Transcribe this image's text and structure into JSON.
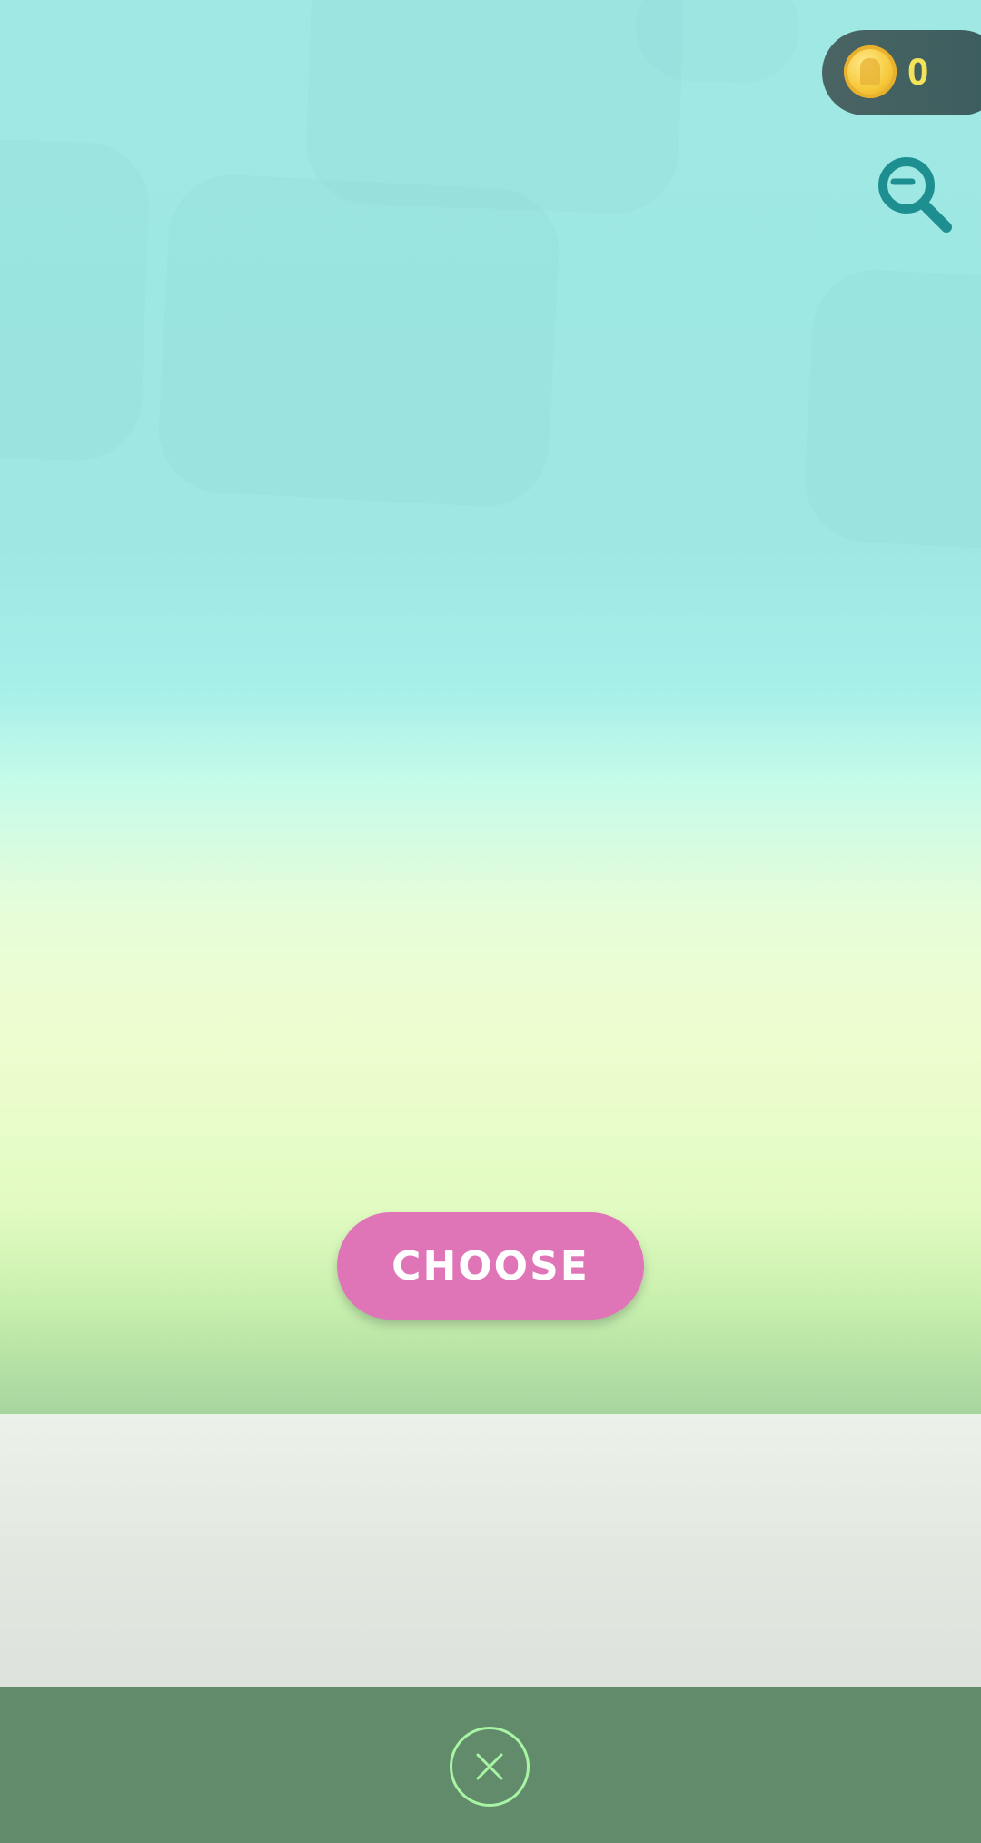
{
  "header": {
    "coin_count": "0",
    "coin_icon": "coin-icon",
    "zoom_icon": "zoom-out-icon"
  },
  "main": {
    "choose_label": "CHOOSE"
  },
  "footer": {
    "close_icon": "close-icon"
  },
  "colors": {
    "choose_button": "#df74b6",
    "coin_text": "#f4e35a",
    "zoom_icon": "#1e8f91",
    "bottom_bar": "#618b6b",
    "close_ring": "#a8f5a4"
  }
}
